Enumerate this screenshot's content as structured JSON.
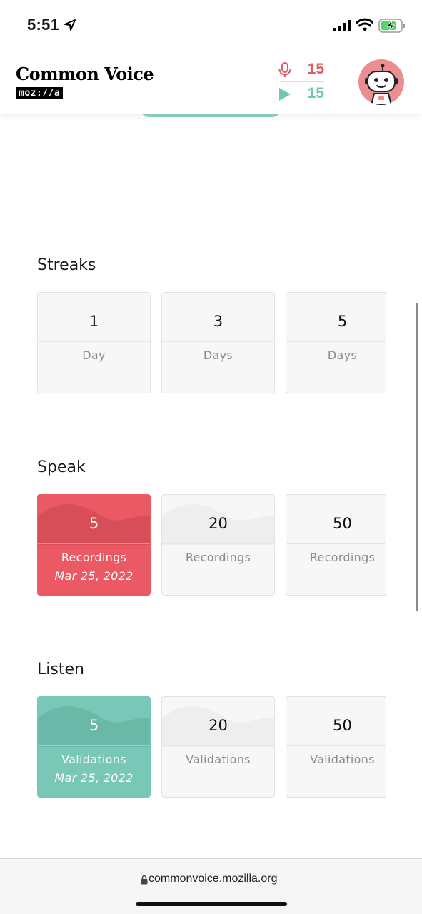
{
  "status_bar": {
    "time": "5:51"
  },
  "header": {
    "title": "Common Voice",
    "subtitle": "moz://a",
    "speak_count": "15",
    "listen_count": "15",
    "colors": {
      "speak": "#e45a62",
      "listen": "#6fc7b6",
      "avatar_bg": "#ea8f91"
    }
  },
  "sections": {
    "streaks": {
      "title": "Streaks",
      "cards": [
        {
          "value": "1",
          "label": "Day"
        },
        {
          "value": "3",
          "label": "Days"
        },
        {
          "value": "5",
          "label": "Days"
        }
      ]
    },
    "speak": {
      "title": "Speak",
      "cards": [
        {
          "value": "5",
          "label": "Recordings",
          "date": "Mar 25, 2022",
          "achieved": true
        },
        {
          "value": "20",
          "label": "Recordings",
          "achieved": false
        },
        {
          "value": "50",
          "label": "Recordings",
          "achieved": false
        }
      ]
    },
    "listen": {
      "title": "Listen",
      "cards": [
        {
          "value": "5",
          "label": "Validations",
          "date": "Mar 25, 2022",
          "achieved": true
        },
        {
          "value": "20",
          "label": "Validations",
          "achieved": false
        },
        {
          "value": "50",
          "label": "Validations",
          "achieved": false
        }
      ]
    }
  },
  "browser": {
    "url": "commonvoice.mozilla.org"
  },
  "colors": {
    "speak_accent": "#eb5a64",
    "listen_accent": "#79c8b7"
  }
}
